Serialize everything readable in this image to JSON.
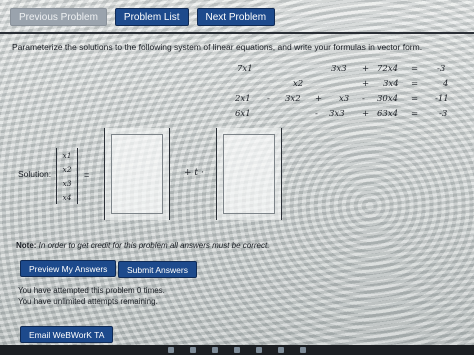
{
  "nav": {
    "previous_label": "Previous Problem",
    "list_label": "Problem List",
    "next_label": "Next Problem"
  },
  "problem": {
    "prompt": "Parameterize the solutions to the following system of linear equations, and write your formulas in vector form.",
    "equations": [
      {
        "t1": "7x1",
        "op1": "",
        "t2": "",
        "op2": "",
        "t3": "3x3",
        "op3": "+",
        "t4": "72x4",
        "eq": "=",
        "rhs": "-3"
      },
      {
        "t1": "",
        "op1": "",
        "t2": "x2",
        "op2": "",
        "t3": "",
        "op3": "+",
        "t4": "3x4",
        "eq": "=",
        "rhs": "4"
      },
      {
        "t1": "2x1",
        "op1": "-",
        "t2": "3x2",
        "op2": "+",
        "t3": "x3",
        "op3": "-",
        "t4": "30x4",
        "eq": "=",
        "rhs": "-11"
      },
      {
        "t1": "6x1",
        "op1": "",
        "t2": "",
        "op2": "-",
        "t3": "3x3",
        "op3": "+",
        "t4": "63x4",
        "eq": "=",
        "rhs": "-3"
      }
    ],
    "solution_label": "Solution:",
    "variables": [
      "x1",
      "x2",
      "x3",
      "x4"
    ],
    "equals": "=",
    "plus_t": "+ t ·"
  },
  "note": {
    "bold": "Note:",
    "text": " In order to get credit for this problem all answers must be correct."
  },
  "actions": {
    "preview_label": "Preview My Answers",
    "submit_label": "Submit Answers",
    "email_label": "Email WeBWorK TA"
  },
  "status": {
    "attempts": "You have attempted this problem 0 times.",
    "remaining": "You have unlimited attempts remaining."
  }
}
